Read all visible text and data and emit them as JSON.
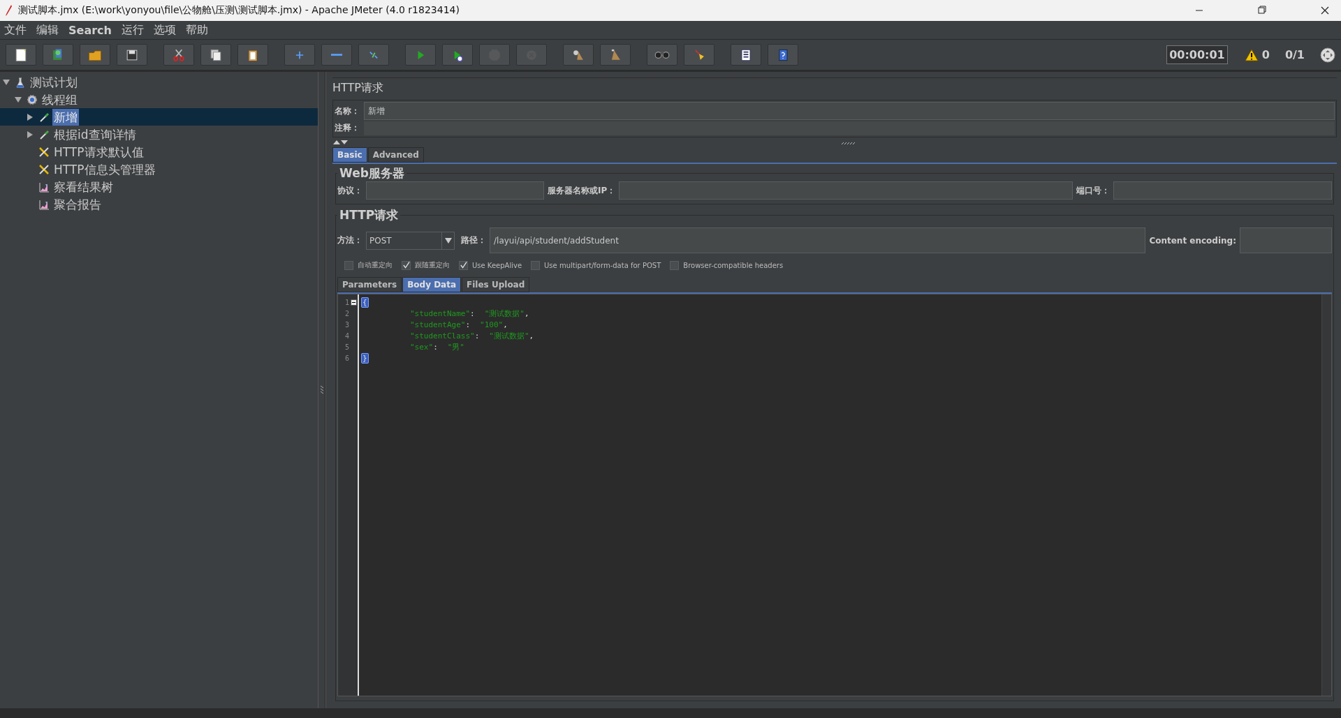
{
  "window": {
    "title": "测试脚本.jmx (E:\\work\\yonyou\\file\\公物舱\\压测\\测试脚本.jmx) - Apache JMeter (4.0 r1823414)"
  },
  "menu": [
    {
      "label": "文件"
    },
    {
      "label": "编辑"
    },
    {
      "label": "Search"
    },
    {
      "label": "运行"
    },
    {
      "label": "选项"
    },
    {
      "label": "帮助"
    }
  ],
  "toolbar": {
    "buttons": [
      {
        "disabled": false
      },
      {
        "disabled": false
      },
      {
        "disabled": false
      },
      {
        "disabled": false
      },
      {
        "disabled": false
      },
      {
        "disabled": false
      },
      {
        "disabled": false
      },
      {
        "disabled": false
      },
      {
        "disabled": false
      },
      {
        "disabled": false
      },
      {
        "disabled": false
      },
      {
        "disabled": false
      },
      {
        "disabled": true
      },
      {
        "disabled": true
      },
      {
        "disabled": false
      },
      {
        "disabled": false
      },
      {
        "disabled": false
      },
      {
        "disabled": false
      },
      {
        "disabled": false
      },
      {
        "disabled": false
      }
    ]
  },
  "status": {
    "timer": "00:00:01",
    "warnings": "0",
    "threads": "0/1"
  },
  "tree": [
    {
      "label": "测试计划",
      "kind": "test-plan",
      "expanded": true,
      "selected": false,
      "children": [
        {
          "label": "线程组",
          "kind": "thread-group",
          "expanded": true,
          "selected": false,
          "children": [
            {
              "label": "新增",
              "kind": "sampler",
              "expanded": false,
              "selected": true
            },
            {
              "label": "根据id查询详情",
              "kind": "sampler",
              "expanded": false,
              "selected": false
            },
            {
              "label": "HTTP请求默认值",
              "kind": "config",
              "selected": false
            },
            {
              "label": "HTTP信息头管理器",
              "kind": "config",
              "selected": false
            },
            {
              "label": "察看结果树",
              "kind": "listener",
              "selected": false
            },
            {
              "label": "聚合报告",
              "kind": "listener",
              "selected": false
            }
          ]
        }
      ]
    }
  ],
  "editor": {
    "title": "HTTP请求",
    "name_label": "名称：",
    "name_value": "新增",
    "comment_label": "注释：",
    "tabs": [
      {
        "label": "Basic",
        "selected": true
      },
      {
        "label": "Advanced",
        "selected": false
      }
    ],
    "web_server": {
      "legend": "Web服务器",
      "protocol_label": "协议：",
      "server_label": "服务器名称或IP：",
      "port_label": "端口号："
    },
    "http_request": {
      "legend": "HTTP请求",
      "method_label": "方法：",
      "method": "POST",
      "path_label": "路径：",
      "path": "/layui/api/student/addStudent",
      "encoding_label": "Content encoding:",
      "options": [
        {
          "label": "自动重定向",
          "checked": false
        },
        {
          "label": "跟随重定向",
          "checked": true
        },
        {
          "label": "Use KeepAlive",
          "checked": true
        },
        {
          "label": "Use multipart/form-data for POST",
          "checked": false
        },
        {
          "label": "Browser-compatible headers",
          "checked": false
        }
      ],
      "tabs": [
        {
          "label": "Parameters",
          "selected": false
        },
        {
          "label": "Body Data",
          "selected": true
        },
        {
          "label": "Files Upload",
          "selected": false
        }
      ],
      "body_lines": [
        {
          "number": "1",
          "foldable": true,
          "indented": false,
          "tokens": [
            {
              "kind": "brace",
              "text": "{"
            }
          ]
        },
        {
          "number": "2",
          "foldable": false,
          "indented": true,
          "tokens": [
            {
              "kind": "key",
              "text": "\"studentName\""
            },
            {
              "kind": "colon",
              "text": ":"
            },
            {
              "kind": "value",
              "text": "\"测试数据\""
            },
            {
              "kind": "comma",
              "text": ","
            }
          ]
        },
        {
          "number": "3",
          "foldable": false,
          "indented": true,
          "tokens": [
            {
              "kind": "key",
              "text": "\"studentAge\""
            },
            {
              "kind": "colon",
              "text": ":"
            },
            {
              "kind": "value",
              "text": "\"100\""
            },
            {
              "kind": "comma",
              "text": ","
            }
          ]
        },
        {
          "number": "4",
          "foldable": false,
          "indented": true,
          "tokens": [
            {
              "kind": "key",
              "text": "\"studentClass\""
            },
            {
              "kind": "colon",
              "text": ":"
            },
            {
              "kind": "value",
              "text": "\"测试数据\""
            },
            {
              "kind": "comma",
              "text": ","
            }
          ]
        },
        {
          "number": "5",
          "foldable": false,
          "indented": true,
          "tokens": [
            {
              "kind": "key",
              "text": "\"sex\""
            },
            {
              "kind": "colon",
              "text": ":"
            },
            {
              "kind": "value",
              "text": "\"男\""
            }
          ]
        },
        {
          "number": "6",
          "foldable": false,
          "indented": false,
          "tokens": [
            {
              "kind": "brace",
              "text": "}"
            }
          ]
        }
      ]
    }
  }
}
